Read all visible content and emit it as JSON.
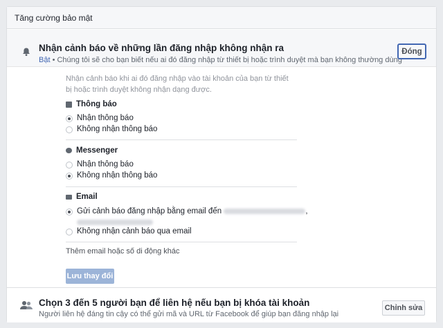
{
  "panel": {
    "title": "Tăng cường bảo mật"
  },
  "login_alerts": {
    "title": "Nhận cảnh báo về những lần đăng nhập không nhận ra",
    "status": "Bật",
    "description": " • Chúng tôi sẽ cho bạn biết nếu ai đó đăng nhập từ thiết bị hoặc trình duyệt mà bạn không thường dùng",
    "close_label": "Đóng",
    "intro": "Nhận cảnh báo khi ai đó đăng nhập vào tài khoản của bạn từ thiết bị hoặc trình duyệt không nhận dạng được.",
    "notifications": {
      "title": "Thông báo",
      "options": [
        "Nhận thông báo",
        "Không nhận thông báo"
      ]
    },
    "messenger": {
      "title": "Messenger",
      "options": [
        "Nhận thông báo",
        "Không nhận thông báo"
      ]
    },
    "email": {
      "title": "Email",
      "send_option": "Gửi cảnh báo đăng nhập bằng email đến",
      "no_option": "Không nhận cảnh báo qua email"
    },
    "add_link": "Thêm email hoặc số di động khác",
    "save_label": "Lưu thay đổi"
  },
  "trusted_contacts": {
    "title": "Chọn 3 đến 5 người bạn để liên hệ nếu bạn bị khóa tài khoản",
    "description": "Người liên hệ đáng tin cậy có thể gửi mã và URL từ Facebook để giúp bạn đăng nhập lại",
    "edit_label": "Chỉnh sửa"
  },
  "icons": [
    "bell-icon",
    "notification-icon",
    "messenger-icon",
    "email-icon",
    "people-icon"
  ]
}
